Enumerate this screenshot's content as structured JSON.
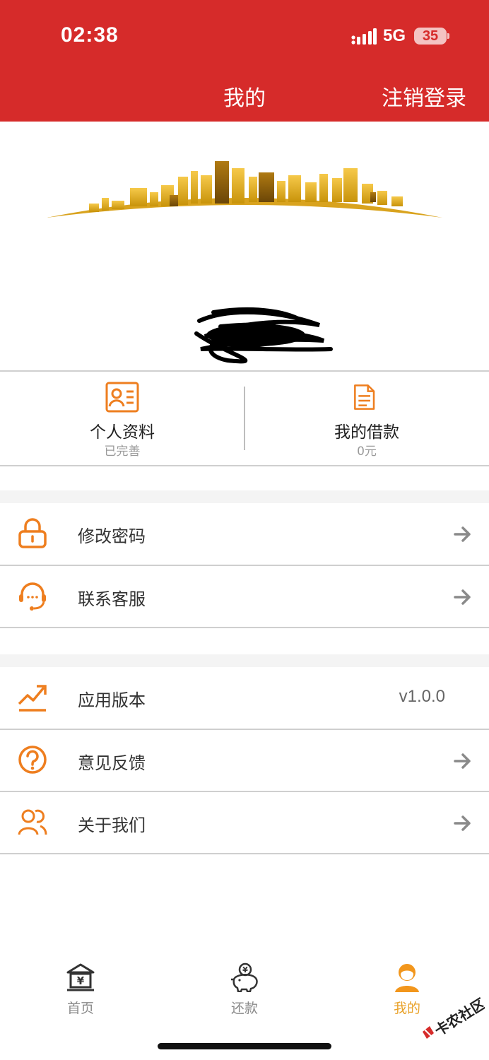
{
  "status_bar": {
    "time": "02:38",
    "network": "5G",
    "battery": "35"
  },
  "header": {
    "title": "我的",
    "logout_label": "注销登录"
  },
  "stats": [
    {
      "label": "个人资料",
      "sub": "已完善"
    },
    {
      "label": "我的借款",
      "sub": "0元"
    }
  ],
  "menu_group_1": [
    {
      "label": "修改密码",
      "icon": "lock-icon"
    },
    {
      "label": "联系客服",
      "icon": "headset-icon"
    }
  ],
  "menu_group_2": [
    {
      "label": "应用版本",
      "icon": "trend-icon",
      "value": "v1.0.0"
    },
    {
      "label": "意见反馈",
      "icon": "question-icon"
    },
    {
      "label": "关于我们",
      "icon": "users-icon"
    }
  ],
  "tabbar": [
    {
      "label": "首页",
      "icon": "bank-icon",
      "active": false
    },
    {
      "label": "还款",
      "icon": "piggy-bank-icon",
      "active": false
    },
    {
      "label": "我的",
      "icon": "person-icon",
      "active": true
    }
  ],
  "watermark": "卡农社区",
  "colors": {
    "header_red": "#d62b2a",
    "accent_orange": "#ee7e1f",
    "active_tab": "#e9a22a"
  }
}
